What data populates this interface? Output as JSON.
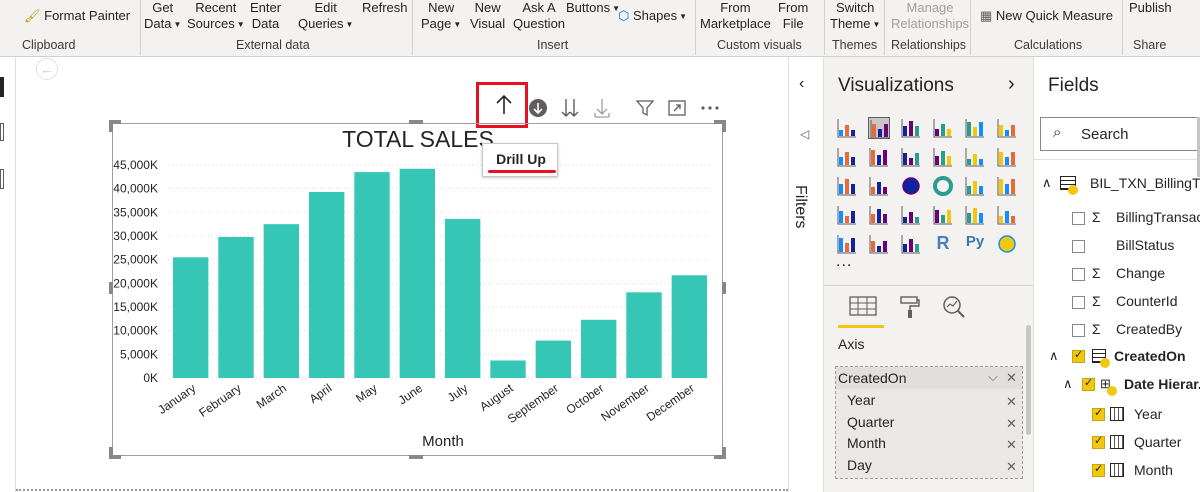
{
  "ribbon": {
    "format_painter": "Format Painter",
    "clipboard": "Clipboard",
    "get_data": [
      "Get",
      "Data"
    ],
    "recent_sources": [
      "Recent",
      "Sources"
    ],
    "enter_data": [
      "Enter",
      "Data"
    ],
    "edit_queries": [
      "Edit",
      "Queries"
    ],
    "refresh": "Refresh",
    "external_data": "External data",
    "new_page": [
      "New",
      "Page"
    ],
    "new_visual": [
      "New",
      "Visual"
    ],
    "ask_question": [
      "Ask A",
      "Question"
    ],
    "buttons": "Buttons",
    "shapes": "Shapes",
    "insert": "Insert",
    "from_marketplace": [
      "From",
      "Marketplace"
    ],
    "from_file": [
      "From",
      "File"
    ],
    "custom_visuals": "Custom visuals",
    "switch_theme": [
      "Switch",
      "Theme"
    ],
    "themes": "Themes",
    "manage_relationships": [
      "Manage",
      "Relationships"
    ],
    "relationships": "Relationships",
    "new_quick_measure": "New Quick Measure",
    "calculations": "Calculations",
    "publish": "Publish",
    "share": "Share"
  },
  "visual": {
    "tooltip": "Drill Up"
  },
  "chart_data": {
    "type": "bar",
    "title": "TOTAL SALES",
    "xlabel": "Month",
    "ylabel": "",
    "categories": [
      "January",
      "February",
      "March",
      "April",
      "May",
      "June",
      "July",
      "August",
      "September",
      "October",
      "November",
      "December"
    ],
    "values": [
      25500,
      29800,
      32500,
      39300,
      43500,
      44200,
      33600,
      3700,
      7900,
      12300,
      18100,
      21700
    ],
    "ylim": [
      0,
      45000
    ],
    "yticks": [
      "0K",
      "5,000K",
      "10,000K",
      "15,000K",
      "20,000K",
      "25,000K",
      "30,000K",
      "35,000K",
      "40,000K",
      "45,000K"
    ],
    "bar_color": "#35c6b6",
    "grid": true
  },
  "filters": {
    "label": "Filters"
  },
  "visualizations": {
    "title": "Visualizations",
    "more": "...",
    "axis_label": "Axis",
    "axis_field": "CreatedOn",
    "axis_items": [
      "Year",
      "Quarter",
      "Month",
      "Day"
    ]
  },
  "fields": {
    "title": "Fields",
    "search_placeholder": "Search",
    "table_name": "BIL_TXN_BillingTr",
    "items": [
      {
        "label": "BillingTransac...",
        "sigma": true,
        "checked": false
      },
      {
        "label": "BillStatus",
        "sigma": false,
        "checked": false
      },
      {
        "label": "Change",
        "sigma": true,
        "checked": false
      },
      {
        "label": "CounterId",
        "sigma": true,
        "checked": false
      },
      {
        "label": "CreatedBy",
        "sigma": true,
        "checked": false
      }
    ],
    "created_on": "CreatedOn",
    "date_hierarchy": "Date Hierar...",
    "hier_items": [
      "Year",
      "Quarter",
      "Month"
    ]
  },
  "colors": {
    "accent": "#f2c80f",
    "highlight": "#e81123"
  }
}
